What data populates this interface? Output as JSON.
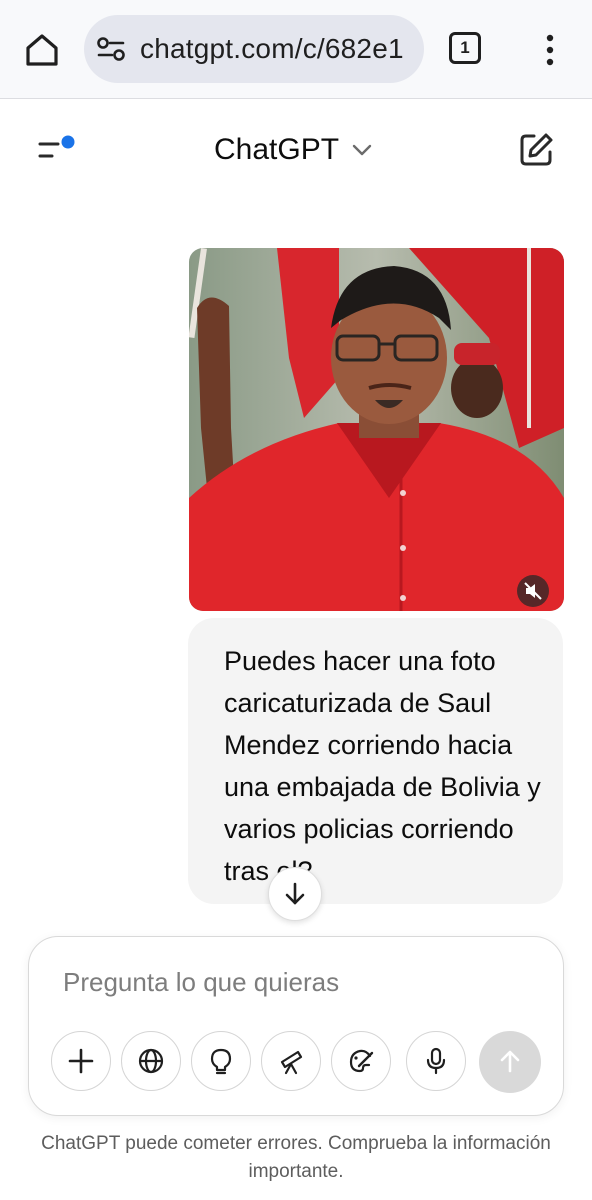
{
  "browser": {
    "url": "chatgpt.com/c/682e1",
    "tab_count": "1",
    "icons": [
      "home-icon",
      "site-settings-icon",
      "tabs-icon",
      "more-vert-icon"
    ]
  },
  "header": {
    "title": "ChatGPT",
    "icons": [
      "sidebar-menu-icon",
      "chevron-down-icon",
      "new-chat-icon"
    ],
    "notification_dot_color": "#1a73e8"
  },
  "message": {
    "text": "Puedes hacer una foto caricaturizada de Saul Mendez corriendo hacia una embajada de Bolivia y varios policias corriendo tras el?",
    "attachment_icons": [
      "volume-off-icon"
    ]
  },
  "composer": {
    "placeholder": "Pregunta lo que quieras",
    "tools": [
      "plus-icon",
      "globe-icon",
      "lightbulb-icon",
      "telescope-icon",
      "paint-icon",
      "microphone-icon",
      "send-arrow-icon"
    ]
  },
  "footer": {
    "disclaimer": "ChatGPT puede cometer errores. Comprueba la información importante."
  },
  "colors": {
    "accent_dot": "#1a73e8",
    "bubble_bg": "#f4f4f4",
    "send_disabled": "#d9d9d9",
    "shirt_red": "#e0262b"
  }
}
